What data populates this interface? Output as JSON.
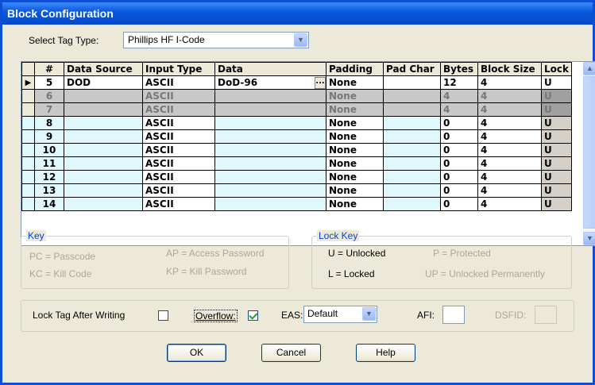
{
  "window": {
    "title": "Block Configuration"
  },
  "tag_type": {
    "label": "Select Tag Type:",
    "value": "Phillips HF I-Code"
  },
  "grid": {
    "columns": [
      "#",
      "Data Source",
      "Input Type",
      "Data",
      "Padding",
      "Pad Char",
      "Bytes",
      "Block Size",
      "Lock"
    ],
    "rows": [
      {
        "num": "5",
        "source": "DOD",
        "input": "ASCII",
        "data": "DoD-96",
        "padding": "None",
        "pad_char": "",
        "bytes": "12",
        "block": "4",
        "lock": "U",
        "state": "selected"
      },
      {
        "num": "6",
        "source": "",
        "input": "ASCII",
        "data": "",
        "padding": "None",
        "pad_char": "",
        "bytes": "4",
        "block": "4",
        "lock": "U",
        "state": "disabled"
      },
      {
        "num": "7",
        "source": "",
        "input": "ASCII",
        "data": "",
        "padding": "None",
        "pad_char": "",
        "bytes": "4",
        "block": "4",
        "lock": "U",
        "state": "disabled"
      },
      {
        "num": "8",
        "source": "",
        "input": "ASCII",
        "data": "",
        "padding": "None",
        "pad_char": "",
        "bytes": "0",
        "block": "4",
        "lock": "U",
        "state": "normal"
      },
      {
        "num": "9",
        "source": "",
        "input": "ASCII",
        "data": "",
        "padding": "None",
        "pad_char": "",
        "bytes": "0",
        "block": "4",
        "lock": "U",
        "state": "normal"
      },
      {
        "num": "10",
        "source": "",
        "input": "ASCII",
        "data": "",
        "padding": "None",
        "pad_char": "",
        "bytes": "0",
        "block": "4",
        "lock": "U",
        "state": "normal"
      },
      {
        "num": "11",
        "source": "",
        "input": "ASCII",
        "data": "",
        "padding": "None",
        "pad_char": "",
        "bytes": "0",
        "block": "4",
        "lock": "U",
        "state": "normal"
      },
      {
        "num": "12",
        "source": "",
        "input": "ASCII",
        "data": "",
        "padding": "None",
        "pad_char": "",
        "bytes": "0",
        "block": "4",
        "lock": "U",
        "state": "normal"
      },
      {
        "num": "13",
        "source": "",
        "input": "ASCII",
        "data": "",
        "padding": "None",
        "pad_char": "",
        "bytes": "0",
        "block": "4",
        "lock": "U",
        "state": "normal"
      },
      {
        "num": "14",
        "source": "",
        "input": "ASCII",
        "data": "",
        "padding": "None",
        "pad_char": "",
        "bytes": "0",
        "block": "4",
        "lock": "U",
        "state": "normal"
      }
    ]
  },
  "key": {
    "title": "Key",
    "pc": "PC = Passcode",
    "ap": "AP = Access Password",
    "kc": "KC = Kill Code",
    "kp": "KP = Kill Password"
  },
  "lock_key": {
    "title": "Lock Key",
    "u": "U = Unlocked",
    "p": "P = Protected",
    "l": "L = Locked",
    "up": "UP = Unlocked Permanently"
  },
  "options": {
    "lock_tag_label": "Lock Tag After Writing",
    "overflow_label": "Overflow:",
    "eas_label": "EAS:",
    "eas_value": "Default",
    "afi_label": "AFI:",
    "afi_value": "",
    "dsfid_label": "DSFID:",
    "dsfid_value": ""
  },
  "buttons": {
    "ok": "OK",
    "cancel": "Cancel",
    "help": "Help"
  },
  "colors": {
    "title_bar": "#0a5ae0",
    "row_bg": "#e0f8fb",
    "disabled_row": "#c8c8c8",
    "group_title": "#0046d5"
  }
}
